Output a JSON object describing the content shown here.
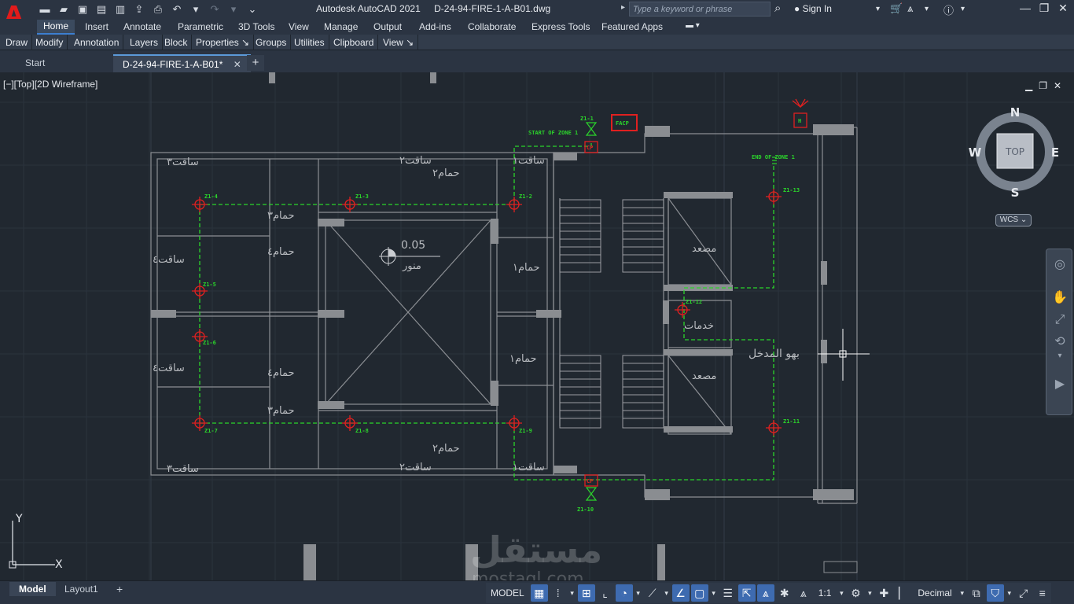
{
  "app": {
    "logo": "A",
    "title": "Autodesk AutoCAD 2021",
    "document": "D-24-94-FIRE-1-A-B01.dwg"
  },
  "search": {
    "placeholder": "Type a keyword or phrase"
  },
  "account": {
    "sign_in": "Sign In"
  },
  "ribbon_tabs": [
    "Home",
    "Insert",
    "Annotate",
    "Parametric",
    "3D Tools",
    "View",
    "Manage",
    "Output",
    "Add-ins",
    "Collaborate",
    "Express Tools",
    "Featured Apps"
  ],
  "panels": [
    "Draw",
    "Modify",
    "Annotation",
    "Layers",
    "Block",
    "Properties ↘",
    "Groups",
    "Utilities",
    "Clipboard",
    "View ↘"
  ],
  "file_tabs": {
    "start": "Start",
    "active": "D-24-94-FIRE-1-A-B01*",
    "close": "✕",
    "new": "+"
  },
  "viewport": {
    "label": "[−][Top][2D Wireframe]"
  },
  "viewcube": {
    "top": "TOP",
    "north": "N",
    "south": "S",
    "east": "E",
    "west": "W",
    "wcs": "WCS ⌄"
  },
  "ucs": {
    "x": "X",
    "y": "Y"
  },
  "drawing": {
    "rooms": {
      "shaft3": "ساقت٣",
      "shaft2": "ساقت٢",
      "shaft1": "ساقت١",
      "shaft4": "ساقت٤",
      "bath2": "حمام٢",
      "bath3": "حمام٣",
      "bath4": "حمام٤",
      "bath1": "حمام١",
      "lightwell": "منور",
      "elevator": "مصعد",
      "services": "خدمات",
      "lobby": "بهو المدخل"
    },
    "level": "0.05",
    "facp": "FACP",
    "horn": "H",
    "cp": "CP",
    "start_zone": "START OF ZONE 1",
    "end_zone": "END OF ZONE 1",
    "detectors": [
      "Z1-1",
      "Z1-2",
      "Z1-3",
      "Z1-4",
      "Z1-5",
      "Z1-6",
      "Z1-7",
      "Z1-8",
      "Z1-9",
      "Z1-10",
      "Z1-11",
      "Z1-12",
      "Z1-13"
    ]
  },
  "watermark": {
    "main": "مستقل",
    "sub": "mostaql.com"
  },
  "layout_tabs": [
    "Model",
    "Layout1"
  ],
  "status": {
    "model": "MODEL",
    "scale": "1:1",
    "units": "Decimal"
  },
  "colors": {
    "accent": "#3e6bb0",
    "wire": "#2bd42b",
    "device": "#e02020",
    "walls": "#8c8f94"
  }
}
